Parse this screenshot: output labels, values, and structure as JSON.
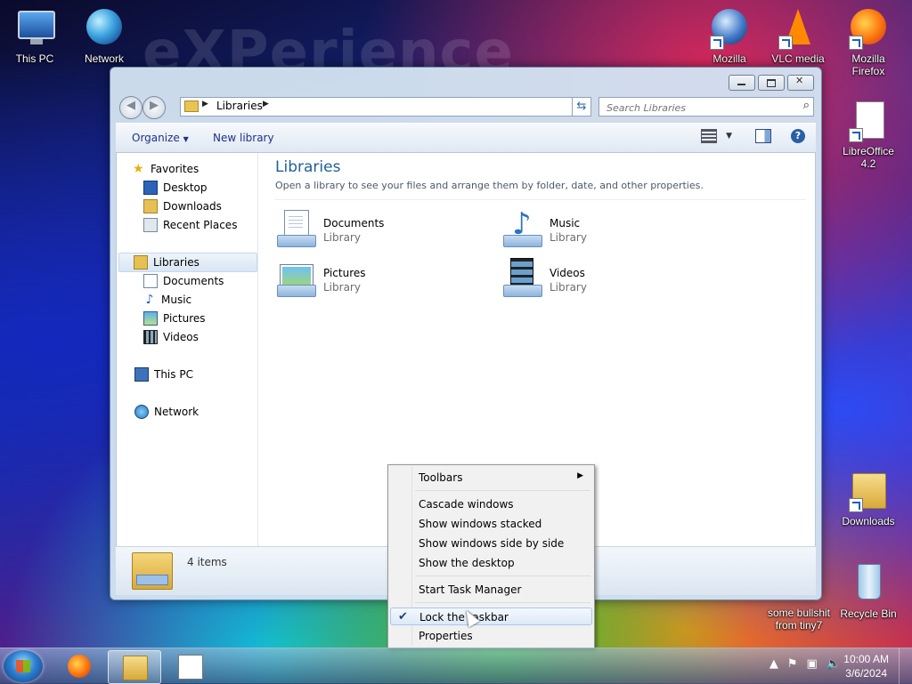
{
  "desktop": {
    "background_text": "eXPerience",
    "icons": [
      {
        "label": "This PC"
      },
      {
        "label": "Network"
      },
      {
        "label": "Mozilla"
      },
      {
        "label": "VLC media"
      },
      {
        "label": "Mozilla Firefox"
      },
      {
        "label": "LibreOffice 4.2"
      },
      {
        "label": "Downloads"
      },
      {
        "label": "some bullshit from tiny7"
      },
      {
        "label": "Recycle Bin"
      }
    ]
  },
  "explorer": {
    "address": {
      "crumb": "Libraries"
    },
    "search": {
      "placeholder": "Search Libraries"
    },
    "toolbar": {
      "organize": "Organize",
      "new_library": "New library"
    },
    "nav": {
      "favorites": "Favorites",
      "desktop": "Desktop",
      "downloads": "Downloads",
      "recent": "Recent Places",
      "libraries": "Libraries",
      "documents": "Documents",
      "music": "Music",
      "pictures": "Pictures",
      "videos": "Videos",
      "this_pc": "This PC",
      "network": "Network"
    },
    "content": {
      "title": "Libraries",
      "subtitle": "Open a library to see your files and arrange them by folder, date, and other properties.",
      "items": [
        {
          "name": "Documents",
          "type": "Library"
        },
        {
          "name": "Music",
          "type": "Library"
        },
        {
          "name": "Pictures",
          "type": "Library"
        },
        {
          "name": "Videos",
          "type": "Library"
        }
      ]
    },
    "details": {
      "count": "4 items"
    }
  },
  "context_menu": {
    "toolbars": "Toolbars",
    "cascade": "Cascade windows",
    "stacked": "Show windows stacked",
    "side_by_side": "Show windows side by side",
    "show_desktop": "Show the desktop",
    "task_manager": "Start Task Manager",
    "lock": "Lock the taskbar",
    "properties": "Properties"
  },
  "taskbar": {
    "time": "10:00 AM",
    "date": "3/6/2024"
  }
}
